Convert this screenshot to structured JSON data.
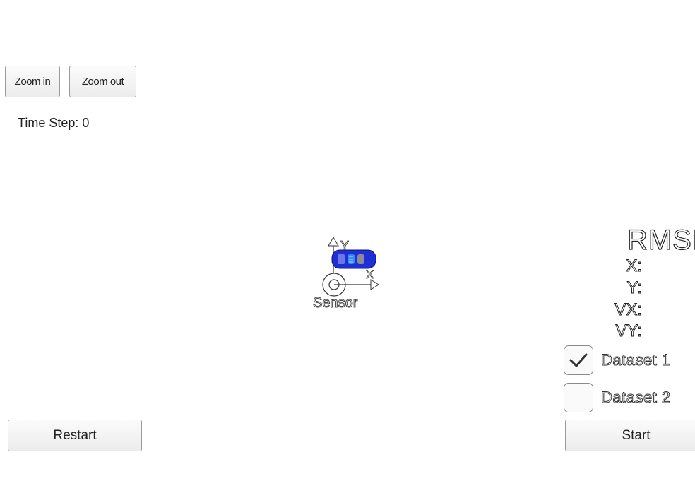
{
  "toolbar": {
    "zoom_in_label": "Zoom in",
    "zoom_out_label": "Zoom out"
  },
  "hud": {
    "time_step_label": "Time Step:",
    "time_step_value": "0"
  },
  "scene": {
    "sensor_label": "Sensor",
    "axis_y_label": "Y",
    "axis_x_label": "X",
    "car_color": "#1f2fd6"
  },
  "rmse": {
    "title": "RMSE",
    "labels": [
      "X:",
      "Y:",
      "VX:",
      "VY:"
    ]
  },
  "datasets": [
    {
      "label": "Dataset 1",
      "checked": true
    },
    {
      "label": "Dataset 2",
      "checked": false
    }
  ],
  "controls": {
    "restart_label": "Restart",
    "start_label": "Start"
  }
}
